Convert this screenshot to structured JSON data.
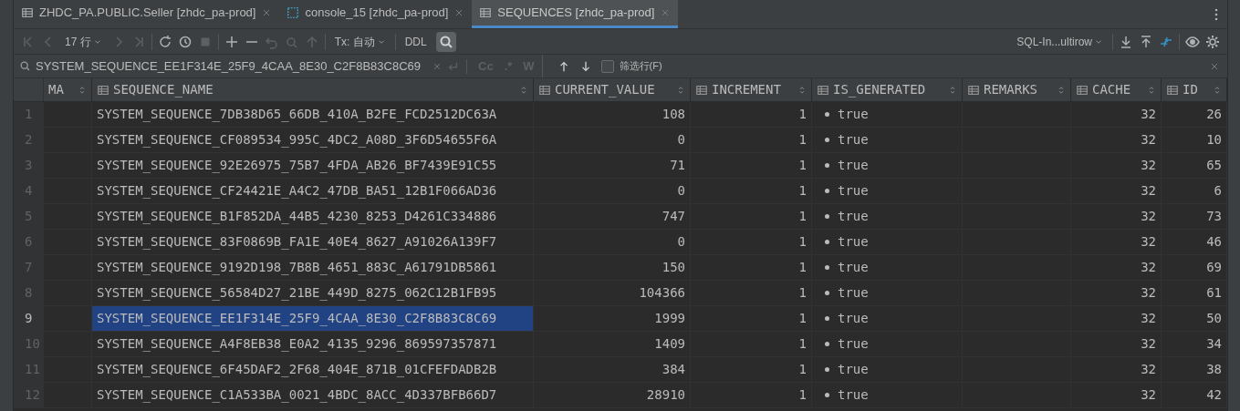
{
  "tabs": [
    {
      "label": "ZHDC_PA.PUBLIC.Seller [zhdc_pa-prod]",
      "kind": "table",
      "selected": false
    },
    {
      "label": "console_15 [zhdc_pa-prod]",
      "kind": "console",
      "selected": false
    },
    {
      "label": "SEQUENCES [zhdc_pa-prod]",
      "kind": "table",
      "selected": true
    }
  ],
  "toolbar": {
    "rows": "17 行",
    "tx": "Tx: 自动",
    "ddl": "DDL",
    "mode": "SQL-In...ultirow"
  },
  "search": {
    "value": "SYSTEM_SEQUENCE_EE1F314E_25F9_4CAA_8E30_C2F8B83C8C69",
    "case": "Cc",
    "regex": ".*",
    "words": "W",
    "filter_label": "筛选行(F)",
    "filter_checked": false
  },
  "table": {
    "columns": [
      {
        "label": "MA",
        "kind": "plain"
      },
      {
        "label": "SEQUENCE_NAME",
        "kind": "table"
      },
      {
        "label": "CURRENT_VALUE",
        "kind": "table"
      },
      {
        "label": "INCREMENT",
        "kind": "table"
      },
      {
        "label": "IS_GENERATED",
        "kind": "table"
      },
      {
        "label": "REMARKS",
        "kind": "table"
      },
      {
        "label": "CACHE",
        "kind": "table"
      },
      {
        "label": "ID",
        "kind": "table"
      }
    ],
    "rows": [
      {
        "num": "1",
        "name": "SYSTEM_SEQUENCE_7DB38D65_66DB_410A_B2FE_FCD2512DC63A",
        "current": "108",
        "increment": "1",
        "generated": "true",
        "cache": "32",
        "id": "26",
        "selected": false
      },
      {
        "num": "2",
        "name": "SYSTEM_SEQUENCE_CF089534_995C_4DC2_A08D_3F6D54655F6A",
        "current": "0",
        "increment": "1",
        "generated": "true",
        "cache": "32",
        "id": "10",
        "selected": false
      },
      {
        "num": "3",
        "name": "SYSTEM_SEQUENCE_92E26975_75B7_4FDA_AB26_BF7439E91C55",
        "current": "71",
        "increment": "1",
        "generated": "true",
        "cache": "32",
        "id": "65",
        "selected": false
      },
      {
        "num": "4",
        "name": "SYSTEM_SEQUENCE_CF24421E_A4C2_47DB_BA51_12B1F066AD36",
        "current": "0",
        "increment": "1",
        "generated": "true",
        "cache": "32",
        "id": "6",
        "selected": false
      },
      {
        "num": "5",
        "name": "SYSTEM_SEQUENCE_B1F852DA_44B5_4230_8253_D4261C334886",
        "current": "747",
        "increment": "1",
        "generated": "true",
        "cache": "32",
        "id": "73",
        "selected": false
      },
      {
        "num": "6",
        "name": "SYSTEM_SEQUENCE_83F0869B_FA1E_40E4_8627_A91026A139F7",
        "current": "0",
        "increment": "1",
        "generated": "true",
        "cache": "32",
        "id": "46",
        "selected": false
      },
      {
        "num": "7",
        "name": "SYSTEM_SEQUENCE_9192D198_7B8B_4651_883C_A61791DB5861",
        "current": "150",
        "increment": "1",
        "generated": "true",
        "cache": "32",
        "id": "69",
        "selected": false
      },
      {
        "num": "8",
        "name": "SYSTEM_SEQUENCE_56584D27_21BE_449D_8275_062C12B1FB95",
        "current": "104366",
        "increment": "1",
        "generated": "true",
        "cache": "32",
        "id": "61",
        "selected": false
      },
      {
        "num": "9",
        "name": "SYSTEM_SEQUENCE_EE1F314E_25F9_4CAA_8E30_C2F8B83C8C69",
        "current": "1999",
        "increment": "1",
        "generated": "true",
        "cache": "32",
        "id": "50",
        "selected": true
      },
      {
        "num": "10",
        "name": "SYSTEM_SEQUENCE_A4F8EB38_E0A2_4135_9296_869597357871",
        "current": "1409",
        "increment": "1",
        "generated": "true",
        "cache": "32",
        "id": "34",
        "selected": false
      },
      {
        "num": "11",
        "name": "SYSTEM_SEQUENCE_6F45DAF2_2F68_404E_871B_01CFEFDADB2B",
        "current": "384",
        "increment": "1",
        "generated": "true",
        "cache": "32",
        "id": "38",
        "selected": false
      },
      {
        "num": "12",
        "name": "SYSTEM_SEQUENCE_C1A533BA_0021_4BDC_8ACC_4D337BFB66D7",
        "current": "28910",
        "increment": "1",
        "generated": "true",
        "cache": "32",
        "id": "42",
        "selected": false
      }
    ]
  }
}
